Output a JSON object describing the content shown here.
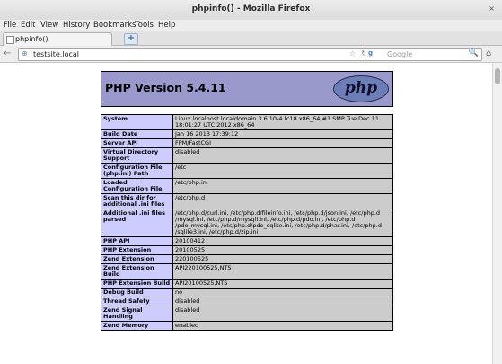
{
  "window": {
    "title": "phpinfo() - Mozilla Firefox",
    "close": "×"
  },
  "menu": [
    "File",
    "Edit",
    "View",
    "History",
    "Bookmarks",
    "Tools",
    "Help"
  ],
  "tab": {
    "title": "phpinfo()",
    "new_tab": "+"
  },
  "nav": {
    "url": "testsite.local",
    "search_placeholder": "Google",
    "back_icon": "←",
    "globe_icon": "⊕",
    "star_icon": "☆",
    "reload_icon": "↻",
    "engine_icon": "g",
    "search_icon": "🔍",
    "home_icon": "⌂"
  },
  "php": {
    "version_title": "PHP Version 5.4.11",
    "logo_text": "php",
    "rows": [
      {
        "label": "System",
        "value": "Linux localhost.localdomain 3.6.10-4.fc18.x86_64 #1 SMP Tue Dec 11 18:01:27 UTC 2012 x86_64"
      },
      {
        "label": "Build Date",
        "value": "Jan 16 2013 17:39:12"
      },
      {
        "label": "Server API",
        "value": "FPM/FastCGI"
      },
      {
        "label": "Virtual Directory Support",
        "value": "disabled"
      },
      {
        "label": "Configuration File (php.ini) Path",
        "value": "/etc"
      },
      {
        "label": "Loaded Configuration File",
        "value": "/etc/php.ini"
      },
      {
        "label": "Scan this dir for additional .ini files",
        "value": "/etc/php.d"
      },
      {
        "label": "Additional .ini files parsed",
        "value": "/etc/php.d/curl.ini, /etc/php.d/fileinfo.ini, /etc/php.d/json.ini, /etc/php.d /mysql.ini, /etc/php.d/mysqli.ini, /etc/php.d/pdo.ini, /etc/php.d /pdo_mysql.ini, /etc/php.d/pdo_sqlite.ini, /etc/php.d/phar.ini, /etc/php.d /sqlite3.ini, /etc/php.d/zip.ini"
      },
      {
        "label": "PHP API",
        "value": "20100412"
      },
      {
        "label": "PHP Extension",
        "value": "20100525"
      },
      {
        "label": "Zend Extension",
        "value": "220100525"
      },
      {
        "label": "Zend Extension Build",
        "value": "API220100525,NTS"
      },
      {
        "label": "PHP Extension Build",
        "value": "API20100525,NTS"
      },
      {
        "label": "Debug Build",
        "value": "no"
      },
      {
        "label": "Thread Safety",
        "value": "disabled"
      },
      {
        "label": "Zend Signal Handling",
        "value": "disabled"
      },
      {
        "label": "Zend Memory",
        "value": "enabled"
      }
    ]
  }
}
